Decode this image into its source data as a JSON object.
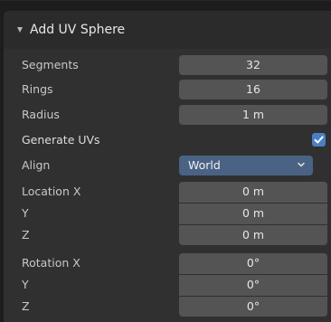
{
  "panel": {
    "title": "Add UV Sphere"
  },
  "fields": {
    "segments": {
      "label": "Segments",
      "value": "32"
    },
    "rings": {
      "label": "Rings",
      "value": "16"
    },
    "radius": {
      "label": "Radius",
      "value": "1 m"
    },
    "generate_uvs": {
      "label": "Generate UVs",
      "checked": true
    },
    "align": {
      "label": "Align",
      "value": "World"
    },
    "location": {
      "x_label": "Location X",
      "x": "0 m",
      "y_label": "Y",
      "y": "0 m",
      "z_label": "Z",
      "z": "0 m"
    },
    "rotation": {
      "x_label": "Rotation X",
      "x": "0°",
      "y_label": "Y",
      "y": "0°",
      "z_label": "Z",
      "z": "0°"
    }
  },
  "colors": {
    "panel_bg": "#303030",
    "field_bg": "#545454",
    "dropdown_bg": "#4a6284",
    "checkbox_bg": "#4b7fc4"
  }
}
